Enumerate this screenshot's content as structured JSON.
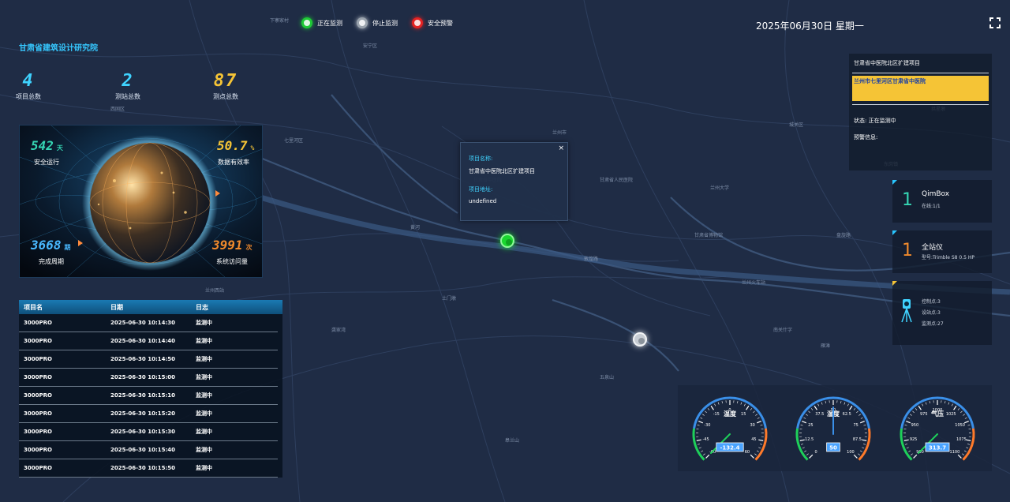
{
  "header": {
    "org_name": "甘肃省建筑设计研究院",
    "date": "2025年06月30日 星期一",
    "legend": [
      {
        "label": "正在监测",
        "color": "#1ec936"
      },
      {
        "label": "停止监测",
        "color": "#9aa3ad"
      },
      {
        "label": "安全预警",
        "color": "#e32222"
      }
    ]
  },
  "stats": [
    {
      "value": "4",
      "label": "项目总数",
      "color": "#3fd3ff"
    },
    {
      "value": "2",
      "label": "测站总数",
      "color": "#3fd3ff"
    },
    {
      "value": "87",
      "label": "测点总数",
      "color": "#f5c436"
    }
  ],
  "globe": {
    "safe_days": {
      "value": "542",
      "unit": "天",
      "label": "安全运行"
    },
    "data_rate": {
      "value": "50.7",
      "unit": "%",
      "label": "数据有效率"
    },
    "periods": {
      "value": "3668",
      "unit": "期",
      "label": "完成周期"
    },
    "visits": {
      "value": "3991",
      "unit": "次",
      "label": "系统访问量"
    }
  },
  "log": {
    "headers": [
      "项目名",
      "日期",
      "日志"
    ],
    "rows": [
      [
        "3000PRO",
        "2025-06-30 10:14:30",
        "监测中"
      ],
      [
        "3000PRO",
        "2025-06-30 10:14:40",
        "监测中"
      ],
      [
        "3000PRO",
        "2025-06-30 10:14:50",
        "监测中"
      ],
      [
        "3000PRO",
        "2025-06-30 10:15:00",
        "监测中"
      ],
      [
        "3000PRO",
        "2025-06-30 10:15:10",
        "监测中"
      ],
      [
        "3000PRO",
        "2025-06-30 10:15:20",
        "监测中"
      ],
      [
        "3000PRO",
        "2025-06-30 10:15:30",
        "监测中"
      ],
      [
        "3000PRO",
        "2025-06-30 10:15:40",
        "监测中"
      ],
      [
        "3000PRO",
        "2025-06-30 10:15:50",
        "监测中"
      ]
    ]
  },
  "popup": {
    "name_label": "项目名称:",
    "name_value": "甘肃省中医院北区扩建项目",
    "address_label": "项目地址:",
    "address_value": "undefined",
    "close": "×"
  },
  "project_panel": {
    "title": "甘肃省中医院北区扩建项目",
    "address": "兰州市七里河区甘肃省中医院",
    "status": "状态: 正在监测中",
    "alarm": "预警信息:"
  },
  "devices": [
    {
      "num": "1",
      "title": "QimBox",
      "sub": "在线:1/1",
      "color": "#35d6b4"
    },
    {
      "num": "1",
      "title": "全站仪",
      "sub": "型号:Trimble S8 0.5 HP",
      "color": "#f08a2c"
    }
  ],
  "points_card": {
    "icon": "total-station-icon",
    "lines": [
      "控制点:3",
      "设站点:3",
      "监测点:27"
    ]
  },
  "map_labels": [
    "下寨家村",
    "西固区",
    "七里河区",
    "兰州市",
    "甘肃省人民医院",
    "兰州大学",
    "城关区",
    "甘肃省博物馆",
    "甘肃省中医院",
    "兰州西站",
    "黄河",
    "东岗镇",
    "五泉山",
    "皋兰山",
    "雁滩",
    "兰州火车站",
    "安宁区",
    "西站街道",
    "土门墩",
    "龚家湾",
    "敦煌路",
    "南关什字",
    "盘旋路",
    "拱星墩"
  ],
  "gauges": [
    {
      "title": "温度",
      "min": -60,
      "max": 60,
      "value": -132.4,
      "display": "-132.4",
      "ticks": [
        "-60",
        "-45",
        "-30",
        "-15",
        "0",
        "15",
        "30",
        "45",
        "60"
      ]
    },
    {
      "title": "湿度",
      "min": 0,
      "max": 100,
      "value": 50,
      "display": "50",
      "ticks": [
        "0",
        "12.5",
        "25",
        "37.5",
        "50",
        "62.5",
        "75",
        "87.5",
        "100"
      ]
    },
    {
      "title": "气压",
      "min": 900,
      "max": 1100,
      "value": 313.7,
      "display": "313.7",
      "ticks": [
        "900",
        "925",
        "950",
        "975",
        "1000",
        "1025",
        "1050",
        "1075",
        "1100"
      ]
    }
  ]
}
